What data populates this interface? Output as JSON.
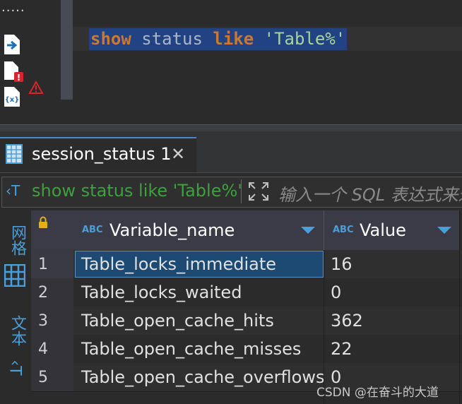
{
  "editor": {
    "sql_text": "show status like 'Table%'",
    "sql_keyword_1": "show",
    "sql_word_2": " status ",
    "sql_keyword_3": "like",
    "sql_string": " 'Table%'",
    "gutter_dots": "....."
  },
  "results": {
    "tab_label": "session_status 1",
    "tab_close": "✕",
    "filter_sql": "show status like 'Table%'",
    "filter_prefix": "‹T",
    "filter_placeholder": "输入一个 SQL 表达式来过滤结果"
  },
  "side_panel": {
    "grid_label": "网格",
    "text_label": "文本"
  },
  "grid": {
    "columns": [
      {
        "type_badge": "ABC",
        "label": "Variable_name"
      },
      {
        "type_badge": "ABC",
        "label": "Value"
      }
    ],
    "rows": [
      {
        "num": "1",
        "name": "Table_locks_immediate",
        "value": "16"
      },
      {
        "num": "2",
        "name": "Table_locks_waited",
        "value": "0"
      },
      {
        "num": "3",
        "name": "Table_open_cache_hits",
        "value": "362"
      },
      {
        "num": "4",
        "name": "Table_open_cache_misses",
        "value": "22"
      },
      {
        "num": "5",
        "name": "Table_open_cache_overflows",
        "value": "0"
      }
    ]
  },
  "watermark": "CSDN @在奋斗的大道",
  "colors": {
    "accent": "#4a9fd8",
    "selection": "#214283",
    "filter_text": "#3da13d"
  }
}
